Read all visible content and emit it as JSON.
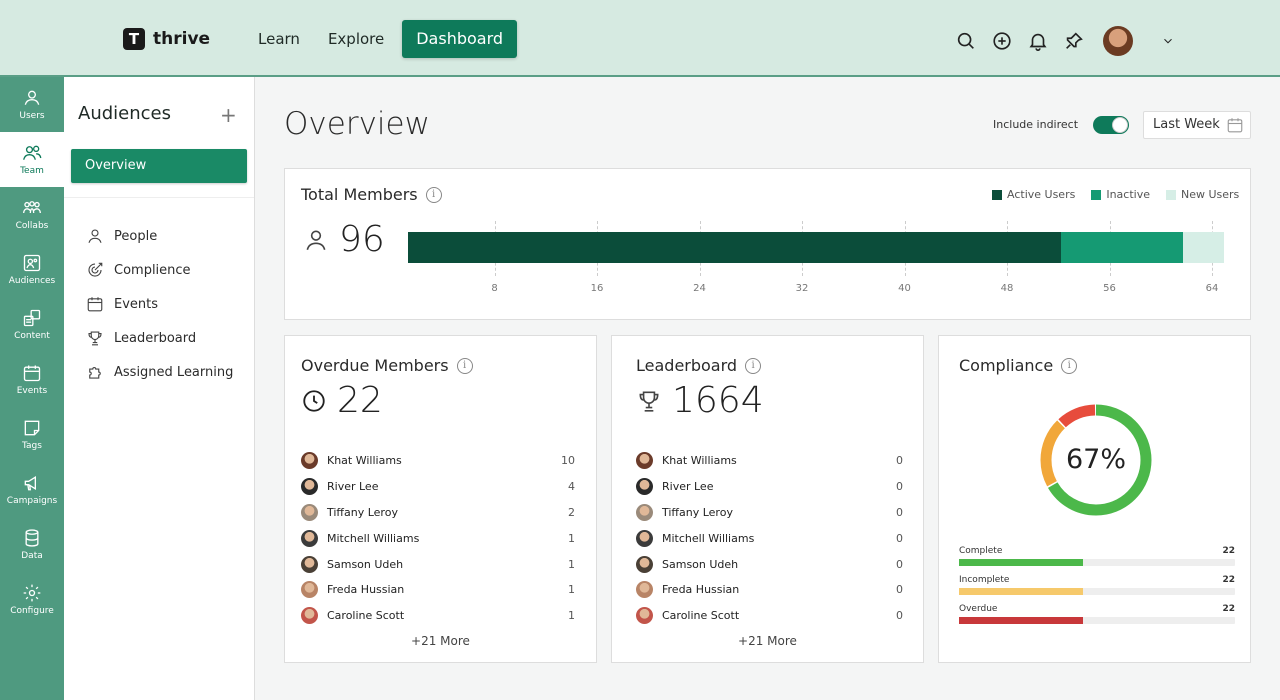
{
  "brand": {
    "name": "thrive",
    "mark": "T"
  },
  "nav": {
    "items": [
      "Learn",
      "Explore"
    ],
    "active": "Dashboard"
  },
  "rail": [
    {
      "label": "Users",
      "icon": "user-icon"
    },
    {
      "label": "Team",
      "icon": "team-icon",
      "active": true
    },
    {
      "label": "Collabs",
      "icon": "collabs-icon"
    },
    {
      "label": "Audiences",
      "icon": "audiences-icon"
    },
    {
      "label": "Content",
      "icon": "content-icon"
    },
    {
      "label": "Events",
      "icon": "calendar-icon"
    },
    {
      "label": "Tags",
      "icon": "tag-icon"
    },
    {
      "label": "Campaigns",
      "icon": "megaphone-icon"
    },
    {
      "label": "Data",
      "icon": "database-icon"
    },
    {
      "label": "Configure",
      "icon": "gear-icon"
    }
  ],
  "sidebar": {
    "title": "Audiences",
    "add": "+",
    "active": "Overview",
    "items": [
      {
        "label": "People",
        "icon": "person-icon"
      },
      {
        "label": "Complience",
        "icon": "compliance-icon"
      },
      {
        "label": "Events",
        "icon": "calendar-icon"
      },
      {
        "label": "Leaderboard",
        "icon": "trophy-icon"
      },
      {
        "label": "Assigned Learning",
        "icon": "puzzle-icon"
      }
    ]
  },
  "main": {
    "title": "Overview",
    "include_indirect": "Include indirect",
    "toggle_on": true,
    "range": "Last Week"
  },
  "total_members": {
    "title": "Total Members",
    "value": "96",
    "legend": [
      {
        "label": "Active Users",
        "color": "#0b4d3a"
      },
      {
        "label": "Inactive",
        "color": "#159a73"
      },
      {
        "label": "New Users",
        "color": "#d6eee6"
      }
    ],
    "ticks": [
      "8",
      "16",
      "24",
      "32",
      "40",
      "48",
      "56",
      "64"
    ],
    "segments": [
      {
        "name": "Active Users",
        "value": 51,
        "color": "#0b4d3a"
      },
      {
        "name": "Inactive",
        "value": 9.5,
        "color": "#159a73"
      },
      {
        "name": "New Users",
        "value": 3.2,
        "color": "#d6eee6"
      }
    ],
    "xmax": 64
  },
  "overdue": {
    "title": "Overdue Members",
    "value": "22",
    "rows": [
      {
        "name": "Khat Williams",
        "value": "10",
        "color": "#6b3b2a"
      },
      {
        "name": "River Lee",
        "value": "4",
        "color": "#2a2a2a"
      },
      {
        "name": "Tiffany Leroy",
        "value": "2",
        "color": "#9a8a7a"
      },
      {
        "name": "Mitchell Williams",
        "value": "1",
        "color": "#3b3b3b"
      },
      {
        "name": "Samson Udeh",
        "value": "1",
        "color": "#4a4036"
      },
      {
        "name": "Freda Hussian",
        "value": "1",
        "color": "#b88466"
      },
      {
        "name": "Caroline Scott",
        "value": "1",
        "color": "#c2554a"
      }
    ],
    "more": "+21 More"
  },
  "leaderboard": {
    "title": "Leaderboard",
    "value": "1664",
    "rows": [
      {
        "name": "Khat Williams",
        "value": "0",
        "color": "#6b3b2a"
      },
      {
        "name": "River Lee",
        "value": "0",
        "color": "#2a2a2a"
      },
      {
        "name": "Tiffany Leroy",
        "value": "0",
        "color": "#9a8a7a"
      },
      {
        "name": "Mitchell Williams",
        "value": "0",
        "color": "#3b3b3b"
      },
      {
        "name": "Samson Udeh",
        "value": "0",
        "color": "#4a4036"
      },
      {
        "name": "Freda Hussian",
        "value": "0",
        "color": "#b88466"
      },
      {
        "name": "Caroline Scott",
        "value": "0",
        "color": "#c2554a"
      }
    ],
    "more": "+21 More"
  },
  "compliance": {
    "title": "Compliance",
    "percent": "67%",
    "donut": [
      {
        "name": "Complete",
        "value": 67,
        "color": "#4cb84a"
      },
      {
        "name": "Incomplete",
        "value": 21,
        "color": "#f1a73a"
      },
      {
        "name": "Overdue",
        "value": 12,
        "color": "#e74c3c"
      }
    ],
    "bars": [
      {
        "label": "Complete",
        "value": "22",
        "fraction": 0.45,
        "color": "#4cb84a"
      },
      {
        "label": "Incomplete",
        "value": "22",
        "fraction": 0.45,
        "color": "#f6c96b"
      },
      {
        "label": "Overdue",
        "value": "22",
        "fraction": 0.45,
        "color": "#c8383a"
      }
    ]
  }
}
